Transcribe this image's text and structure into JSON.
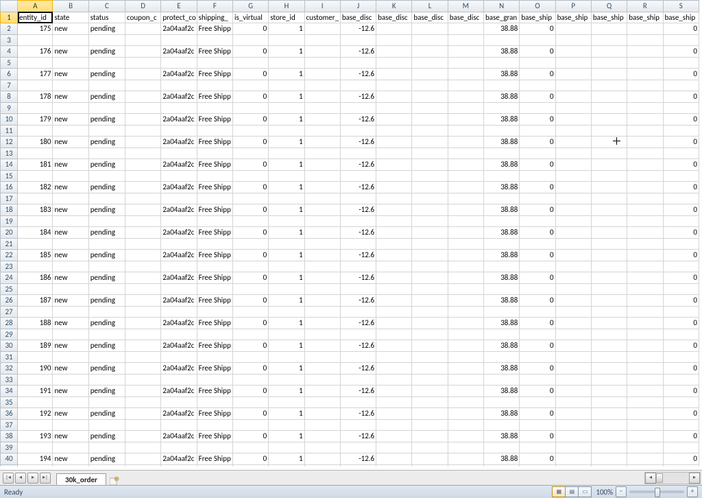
{
  "active_cell": "A1",
  "columns": [
    "A",
    "B",
    "C",
    "D",
    "E",
    "F",
    "G",
    "H",
    "I",
    "J",
    "K",
    "L",
    "M",
    "N",
    "O",
    "P",
    "Q",
    "R",
    "S"
  ],
  "headers": {
    "A": "entity_id",
    "B": "state",
    "C": "status",
    "D": "coupon_c",
    "E": "protect_co",
    "F": "shipping_",
    "G": "is_virtual",
    "H": "store_id",
    "I": "customer_",
    "J": "base_disc",
    "K": "base_disc",
    "L": "base_disc",
    "M": "base_disc",
    "N": "base_gran",
    "O": "base_ship",
    "P": "base_ship",
    "Q": "base_ship",
    "R": "base_ship",
    "S": "base_ship"
  },
  "data_row_template": {
    "B": "new",
    "C": "pending",
    "D": "",
    "E": "2a04aaf2c",
    "F": "Free Shipp",
    "G": "0",
    "H": "1",
    "I": "",
    "J": "-12.6",
    "K": "",
    "L": "",
    "M": "",
    "N": "38.88",
    "O": "0",
    "P": "",
    "Q": "",
    "R": "",
    "S": "0"
  },
  "entity_ids_by_sheet_row": {
    "2": "175",
    "4": "176",
    "6": "177",
    "8": "178",
    "10": "179",
    "12": "180",
    "14": "181",
    "16": "182",
    "18": "183",
    "20": "184",
    "22": "185",
    "24": "186",
    "26": "187",
    "28": "188",
    "30": "189",
    "32": "190",
    "34": "191",
    "36": "192",
    "38": "193",
    "40": "194"
  },
  "numeric_cols": [
    "A",
    "G",
    "H",
    "J",
    "N",
    "O",
    "S"
  ],
  "total_rows": 41,
  "data_rows": [
    2,
    4,
    6,
    8,
    10,
    12,
    14,
    16,
    18,
    20,
    22,
    24,
    26,
    28,
    30,
    32,
    34,
    36,
    38,
    40
  ],
  "sheet_tab": {
    "name": "30k_order",
    "active": true
  },
  "statusbar": {
    "text": "Ready",
    "zoom_pct": "100%"
  }
}
